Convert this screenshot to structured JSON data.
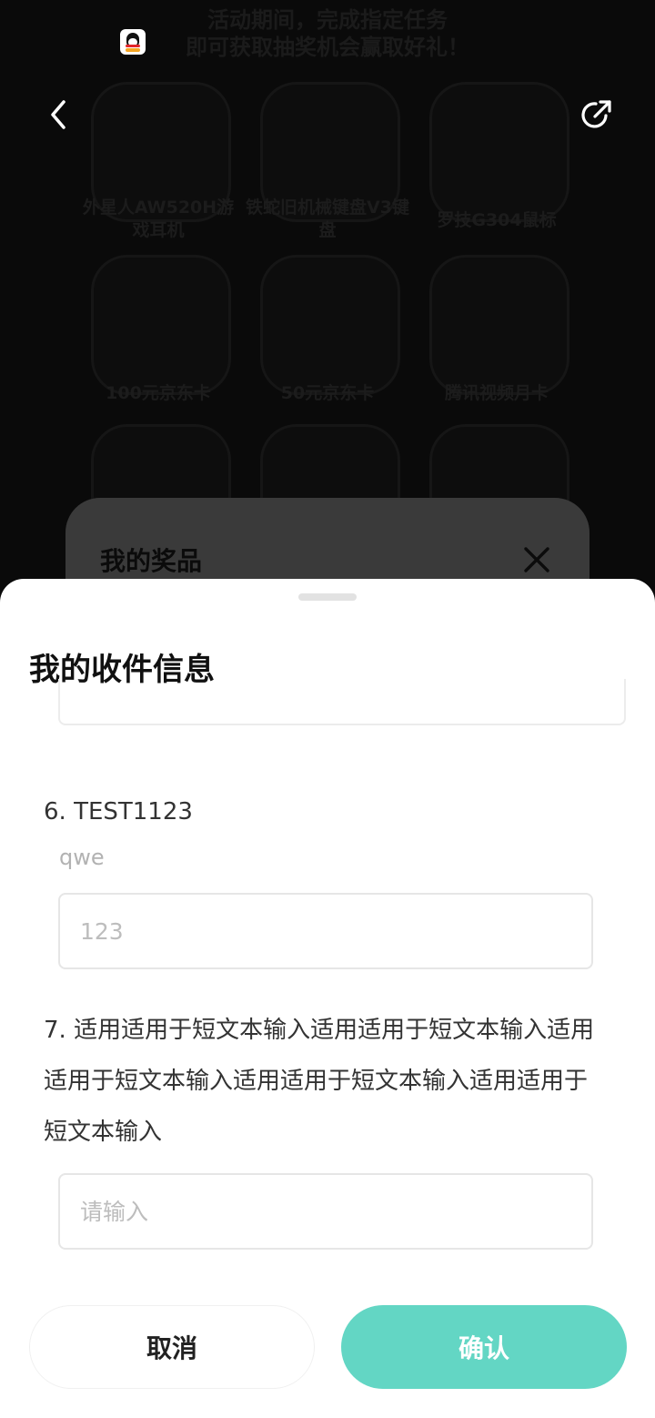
{
  "background": {
    "banner_line1": "活动期间，完成指定任务",
    "banner_line2": "即可获取抽奖机会赢取好礼！",
    "prizes": [
      {
        "name": "外星人AW520H游戏耳机"
      },
      {
        "name": "铁蛇旧机械键盘V3键盘"
      },
      {
        "name": "罗技G304鼠标"
      },
      {
        "name": "100元京东卡"
      },
      {
        "name": "50元京东卡"
      },
      {
        "name": "腾讯视频月卡"
      }
    ]
  },
  "nav": {
    "back_icon": "chevron-left-icon",
    "share_icon": "share-icon"
  },
  "prize_card": {
    "title": "我的奖品",
    "close_icon": "close-icon"
  },
  "sheet": {
    "title": "我的收件信息",
    "questions": [
      {
        "label": "6. TEST1123",
        "description": "qwe",
        "value": "",
        "placeholder": "123"
      },
      {
        "label": "7. 适用适用于短文本输入适用适用于短文本输入适用适用于短文本输入适用适用于短文本输入适用适用于短文本输入",
        "value": "",
        "placeholder": "请输入"
      }
    ],
    "cancel_label": "取消",
    "confirm_label": "确认"
  },
  "colors": {
    "accent": "#63d6c4",
    "sheet_bg": "#ffffff",
    "overlay": "#0a0a0a"
  }
}
